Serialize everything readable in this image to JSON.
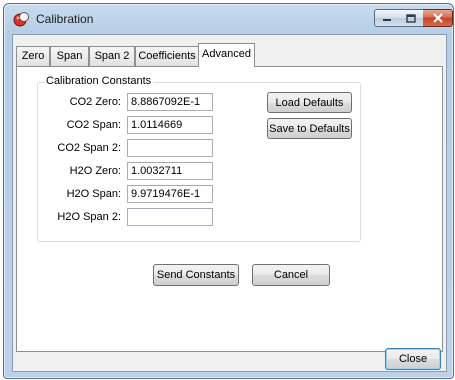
{
  "window": {
    "title": "Calibration"
  },
  "tabs": [
    {
      "label": "Zero",
      "active": false
    },
    {
      "label": "Span",
      "active": false
    },
    {
      "label": "Span 2",
      "active": false
    },
    {
      "label": "Coefficients",
      "active": false
    },
    {
      "label": "Advanced",
      "active": true
    }
  ],
  "group": {
    "title": "Calibration Constants",
    "fields": [
      {
        "label": "CO2 Zero:",
        "value": "8.8867092E-1"
      },
      {
        "label": "CO2 Span:",
        "value": "1.0114669"
      },
      {
        "label": "CO2 Span 2:",
        "value": ""
      },
      {
        "label": "H2O Zero:",
        "value": "1.0032711"
      },
      {
        "label": "H2O Span:",
        "value": "9.9719476E-1"
      },
      {
        "label": "H2O Span 2:",
        "value": ""
      }
    ]
  },
  "buttons": {
    "load_defaults": "Load Defaults",
    "save_to_defaults": "Save to Defaults",
    "send_constants": "Send Constants",
    "cancel": "Cancel",
    "close": "Close"
  },
  "icons": {
    "app": "calibration-app-icon",
    "minimize": "minimize-icon",
    "maximize": "maximize-icon",
    "close": "close-icon"
  },
  "colors": {
    "title_bar": "#c4d8ee",
    "close_button": "#c94a32",
    "client_background": "#f0f0f0",
    "panel_background": "#ffffff"
  }
}
